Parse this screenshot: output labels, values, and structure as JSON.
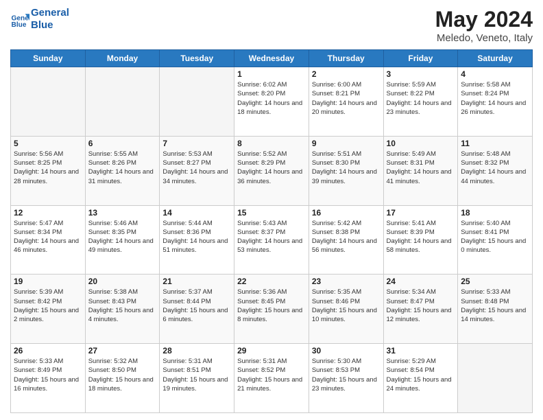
{
  "header": {
    "logo_line1": "General",
    "logo_line2": "Blue",
    "title": "May 2024",
    "subtitle": "Meledo, Veneto, Italy"
  },
  "weekdays": [
    "Sunday",
    "Monday",
    "Tuesday",
    "Wednesday",
    "Thursday",
    "Friday",
    "Saturday"
  ],
  "weeks": [
    [
      {
        "day": "",
        "info": ""
      },
      {
        "day": "",
        "info": ""
      },
      {
        "day": "",
        "info": ""
      },
      {
        "day": "1",
        "info": "Sunrise: 6:02 AM\nSunset: 8:20 PM\nDaylight: 14 hours\nand 18 minutes."
      },
      {
        "day": "2",
        "info": "Sunrise: 6:00 AM\nSunset: 8:21 PM\nDaylight: 14 hours\nand 20 minutes."
      },
      {
        "day": "3",
        "info": "Sunrise: 5:59 AM\nSunset: 8:22 PM\nDaylight: 14 hours\nand 23 minutes."
      },
      {
        "day": "4",
        "info": "Sunrise: 5:58 AM\nSunset: 8:24 PM\nDaylight: 14 hours\nand 26 minutes."
      }
    ],
    [
      {
        "day": "5",
        "info": "Sunrise: 5:56 AM\nSunset: 8:25 PM\nDaylight: 14 hours\nand 28 minutes."
      },
      {
        "day": "6",
        "info": "Sunrise: 5:55 AM\nSunset: 8:26 PM\nDaylight: 14 hours\nand 31 minutes."
      },
      {
        "day": "7",
        "info": "Sunrise: 5:53 AM\nSunset: 8:27 PM\nDaylight: 14 hours\nand 34 minutes."
      },
      {
        "day": "8",
        "info": "Sunrise: 5:52 AM\nSunset: 8:29 PM\nDaylight: 14 hours\nand 36 minutes."
      },
      {
        "day": "9",
        "info": "Sunrise: 5:51 AM\nSunset: 8:30 PM\nDaylight: 14 hours\nand 39 minutes."
      },
      {
        "day": "10",
        "info": "Sunrise: 5:49 AM\nSunset: 8:31 PM\nDaylight: 14 hours\nand 41 minutes."
      },
      {
        "day": "11",
        "info": "Sunrise: 5:48 AM\nSunset: 8:32 PM\nDaylight: 14 hours\nand 44 minutes."
      }
    ],
    [
      {
        "day": "12",
        "info": "Sunrise: 5:47 AM\nSunset: 8:34 PM\nDaylight: 14 hours\nand 46 minutes."
      },
      {
        "day": "13",
        "info": "Sunrise: 5:46 AM\nSunset: 8:35 PM\nDaylight: 14 hours\nand 49 minutes."
      },
      {
        "day": "14",
        "info": "Sunrise: 5:44 AM\nSunset: 8:36 PM\nDaylight: 14 hours\nand 51 minutes."
      },
      {
        "day": "15",
        "info": "Sunrise: 5:43 AM\nSunset: 8:37 PM\nDaylight: 14 hours\nand 53 minutes."
      },
      {
        "day": "16",
        "info": "Sunrise: 5:42 AM\nSunset: 8:38 PM\nDaylight: 14 hours\nand 56 minutes."
      },
      {
        "day": "17",
        "info": "Sunrise: 5:41 AM\nSunset: 8:39 PM\nDaylight: 14 hours\nand 58 minutes."
      },
      {
        "day": "18",
        "info": "Sunrise: 5:40 AM\nSunset: 8:41 PM\nDaylight: 15 hours\nand 0 minutes."
      }
    ],
    [
      {
        "day": "19",
        "info": "Sunrise: 5:39 AM\nSunset: 8:42 PM\nDaylight: 15 hours\nand 2 minutes."
      },
      {
        "day": "20",
        "info": "Sunrise: 5:38 AM\nSunset: 8:43 PM\nDaylight: 15 hours\nand 4 minutes."
      },
      {
        "day": "21",
        "info": "Sunrise: 5:37 AM\nSunset: 8:44 PM\nDaylight: 15 hours\nand 6 minutes."
      },
      {
        "day": "22",
        "info": "Sunrise: 5:36 AM\nSunset: 8:45 PM\nDaylight: 15 hours\nand 8 minutes."
      },
      {
        "day": "23",
        "info": "Sunrise: 5:35 AM\nSunset: 8:46 PM\nDaylight: 15 hours\nand 10 minutes."
      },
      {
        "day": "24",
        "info": "Sunrise: 5:34 AM\nSunset: 8:47 PM\nDaylight: 15 hours\nand 12 minutes."
      },
      {
        "day": "25",
        "info": "Sunrise: 5:33 AM\nSunset: 8:48 PM\nDaylight: 15 hours\nand 14 minutes."
      }
    ],
    [
      {
        "day": "26",
        "info": "Sunrise: 5:33 AM\nSunset: 8:49 PM\nDaylight: 15 hours\nand 16 minutes."
      },
      {
        "day": "27",
        "info": "Sunrise: 5:32 AM\nSunset: 8:50 PM\nDaylight: 15 hours\nand 18 minutes."
      },
      {
        "day": "28",
        "info": "Sunrise: 5:31 AM\nSunset: 8:51 PM\nDaylight: 15 hours\nand 19 minutes."
      },
      {
        "day": "29",
        "info": "Sunrise: 5:31 AM\nSunset: 8:52 PM\nDaylight: 15 hours\nand 21 minutes."
      },
      {
        "day": "30",
        "info": "Sunrise: 5:30 AM\nSunset: 8:53 PM\nDaylight: 15 hours\nand 23 minutes."
      },
      {
        "day": "31",
        "info": "Sunrise: 5:29 AM\nSunset: 8:54 PM\nDaylight: 15 hours\nand 24 minutes."
      },
      {
        "day": "",
        "info": ""
      }
    ]
  ]
}
